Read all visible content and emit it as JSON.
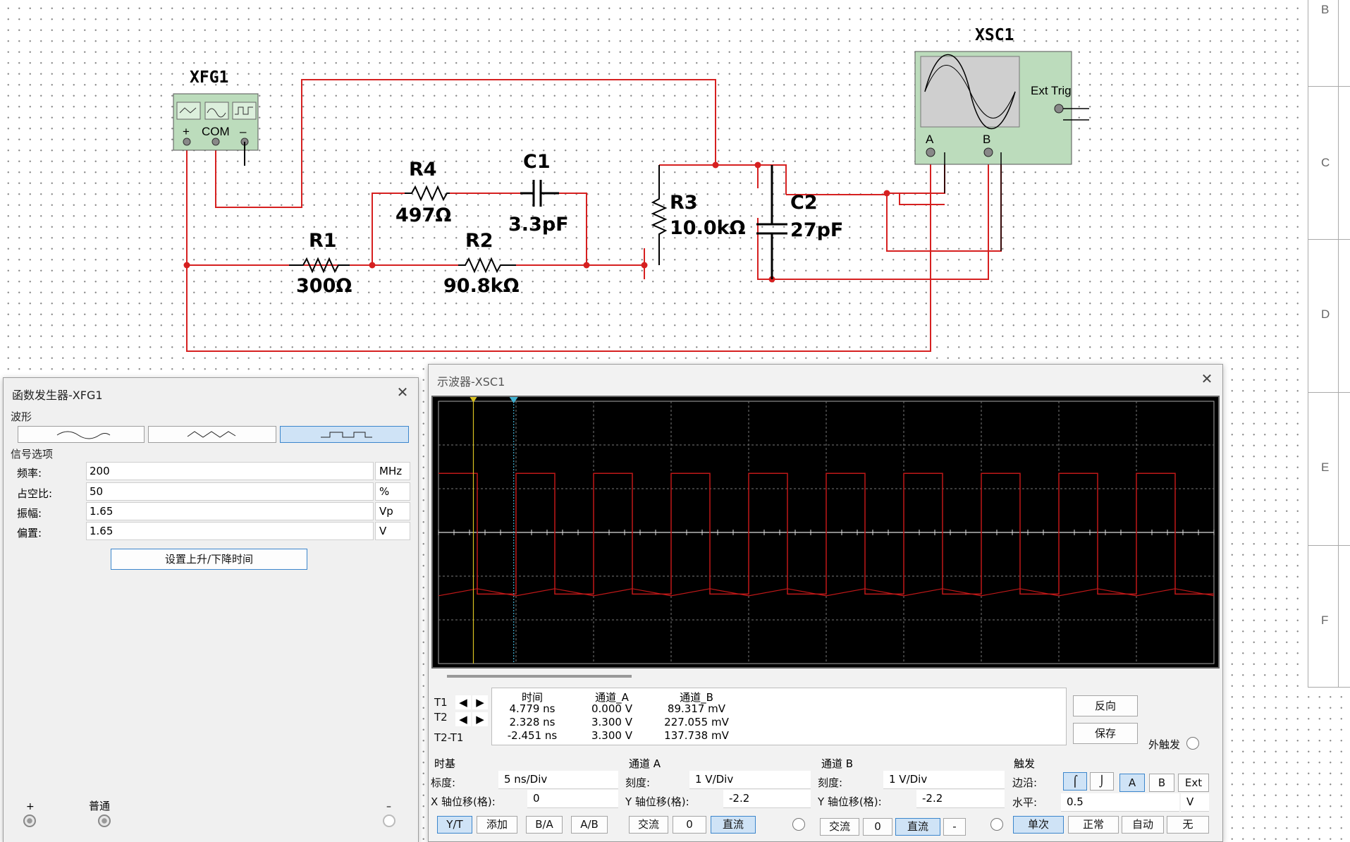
{
  "schematic": {
    "instruments": {
      "xfg1": {
        "label": "XFG1",
        "com": "COM",
        "plus": "+",
        "minus": "–"
      },
      "xsc1": {
        "label": "XSC1",
        "ext_trig": "Ext Trig",
        "ch_a": "A",
        "ch_b": "B"
      }
    },
    "components": {
      "r1": {
        "name": "R1",
        "value": "300Ω"
      },
      "r2": {
        "name": "R2",
        "value": "90.8kΩ"
      },
      "r3": {
        "name": "R3",
        "value": "10.0kΩ"
      },
      "r4": {
        "name": "R4",
        "value": "497Ω"
      },
      "c1": {
        "name": "C1",
        "value": "3.3pF"
      },
      "c2": {
        "name": "C2",
        "value": "27pF"
      }
    },
    "wire_color": "#d62020",
    "border_zones": [
      "B",
      "C",
      "D",
      "E",
      "F"
    ]
  },
  "function_generator": {
    "title": "函数发生器-XFG1",
    "waveform_group": "波形",
    "waveforms": [
      "sine",
      "triangle",
      "square"
    ],
    "selected_waveform": "square",
    "signal_options_group": "信号选项",
    "fields": [
      {
        "label": "频率:",
        "value": "200",
        "unit": "MHz"
      },
      {
        "label": "占空比:",
        "value": "50",
        "unit": "%"
      },
      {
        "label": "振幅:",
        "value": "1.65",
        "unit": "Vp"
      },
      {
        "label": "偏置:",
        "value": "1.65",
        "unit": "V"
      }
    ],
    "rise_fall_button": "设置上升/下降时间",
    "terminals": {
      "plus": "+",
      "common": "普通",
      "minus": "–"
    }
  },
  "oscilloscope": {
    "title": "示波器-XSC1",
    "readout": {
      "headers": [
        "时间",
        "通道_A",
        "通道_B"
      ],
      "rows": [
        {
          "label": "T1",
          "time": "4.779 ns",
          "a": "0.000 V",
          "b": "89.317 mV"
        },
        {
          "label": "T2",
          "time": "2.328 ns",
          "a": "3.300 V",
          "b": "227.055 mV"
        },
        {
          "label": "T2-T1",
          "time": "-2.451 ns",
          "a": "3.300 V",
          "b": "137.738 mV"
        }
      ]
    },
    "reverse_button": "反向",
    "save_button": "保存",
    "ext_trigger_label": "外触发",
    "timebase": {
      "group": "时基",
      "scale_label": "标度:",
      "scale": "5 ns/Div",
      "xpos_label": "X 轴位移(格):",
      "xpos": "0",
      "buttons": [
        "Y/T",
        "添加",
        "B/A",
        "A/B"
      ],
      "active": "Y/T"
    },
    "channel_a": {
      "group": "通道 A",
      "scale_label": "刻度:",
      "scale": "1  V/Div",
      "ypos_label": "Y 轴位移(格):",
      "ypos": "-2.2",
      "coupling": [
        "交流",
        "0",
        "直流"
      ],
      "active": "直流"
    },
    "channel_b": {
      "group": "通道 B",
      "scale_label": "刻度:",
      "scale": "1  V/Div",
      "ypos_label": "Y 轴位移(格):",
      "ypos": "-2.2",
      "coupling": [
        "交流",
        "0",
        "直流",
        "-"
      ],
      "active": "直流"
    },
    "trigger": {
      "group": "触发",
      "edge_label": "边沿:",
      "sources": [
        "A",
        "B",
        "Ext"
      ],
      "active_source": "A",
      "level_label": "水平:",
      "level": "0.5",
      "level_unit": "V",
      "modes": [
        "单次",
        "正常",
        "自动",
        "无"
      ],
      "active_mode": "单次"
    },
    "trace_colors": {
      "channel_a": "#c01818",
      "channel_b": "#c01818",
      "cursor_t1": "#d8c020",
      "cursor_t2": "#40b0d0"
    }
  }
}
